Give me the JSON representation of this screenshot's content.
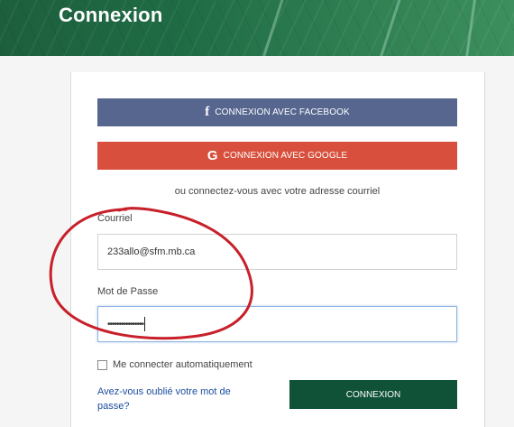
{
  "header": {
    "title": "Connexion"
  },
  "social": {
    "facebook_label": "CONNEXION AVEC FACEBOOK",
    "facebook_icon": "f",
    "google_label": "CONNEXION AVEC GOOGLE",
    "google_icon": "G"
  },
  "or_text": "ou connectez-vous avec votre adresse courriel",
  "email": {
    "label": "Courriel",
    "value": "233allo@sfm.mb.ca"
  },
  "password": {
    "label": "Mot de Passe",
    "value": "••••••••••••••••"
  },
  "remember_label": "Me connecter automatiquement",
  "forgot_link": "Avez-vous oublié votre mot de passe?",
  "submit_label": "CONNEXION",
  "colors": {
    "facebook": "#56668f",
    "google": "#d8503d",
    "submit": "#0f5238",
    "annotation": "#c8202a"
  }
}
